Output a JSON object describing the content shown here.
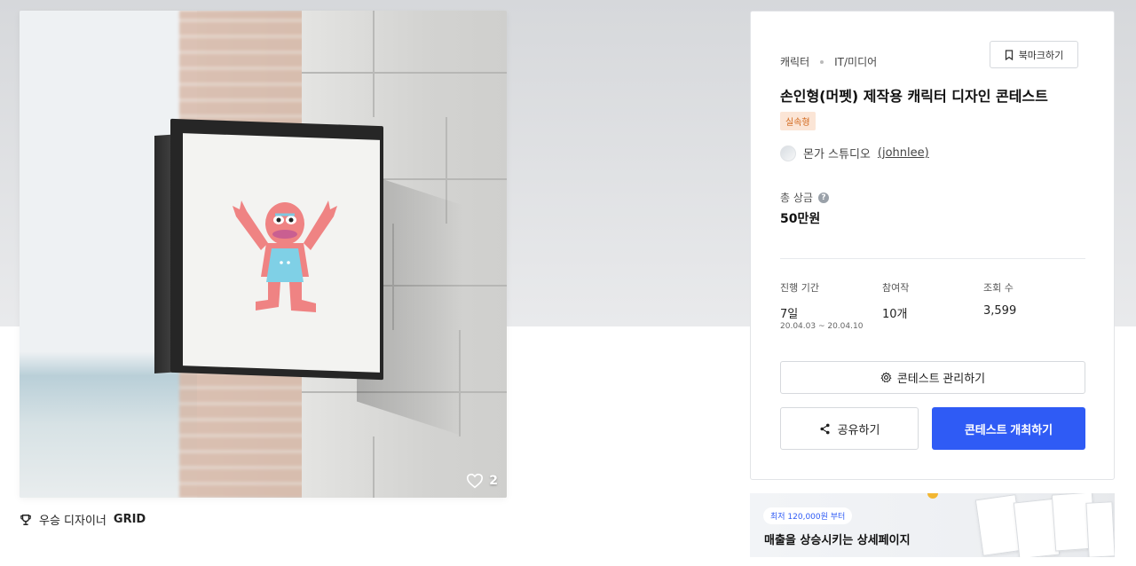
{
  "hero": {
    "like_count": "2"
  },
  "award": {
    "prefix": "우승 디자이너",
    "name": "GRID"
  },
  "contest": {
    "category": "캐릭터",
    "subcategory": "IT/미디어",
    "bookmark_label": "북마크하기",
    "title": "손인형(머펫) 제작용 캐릭터 디자인 콘테스트",
    "tag": "실속형",
    "owner_name": "몬가 스튜디오",
    "owner_handle": "(johnlee)",
    "prize_label": "총 상금",
    "prize_value": "50만원",
    "stats": {
      "period_label": "진행 기간",
      "period_value": "7일",
      "period_dates": "20.04.03  ~  20.04.10",
      "entries_label": "참여작",
      "entries_value": "10개",
      "views_label": "조회 수",
      "views_value": "3,599"
    },
    "manage_button": "콘테스트 관리하기",
    "share_button": "공유하기",
    "host_button": "콘테스트 개최하기"
  },
  "banner": {
    "pill": "최저 120,000원 부터",
    "text": "매출을 상승시키는 상세페이지"
  },
  "colors": {
    "primary": "#2f5bf5",
    "tag_bg": "#fbe5d6",
    "tag_text": "#d2691e"
  },
  "icons": [
    "heart-icon",
    "trophy-icon",
    "bookmark-icon",
    "help-icon",
    "gear-icon",
    "share-icon"
  ]
}
